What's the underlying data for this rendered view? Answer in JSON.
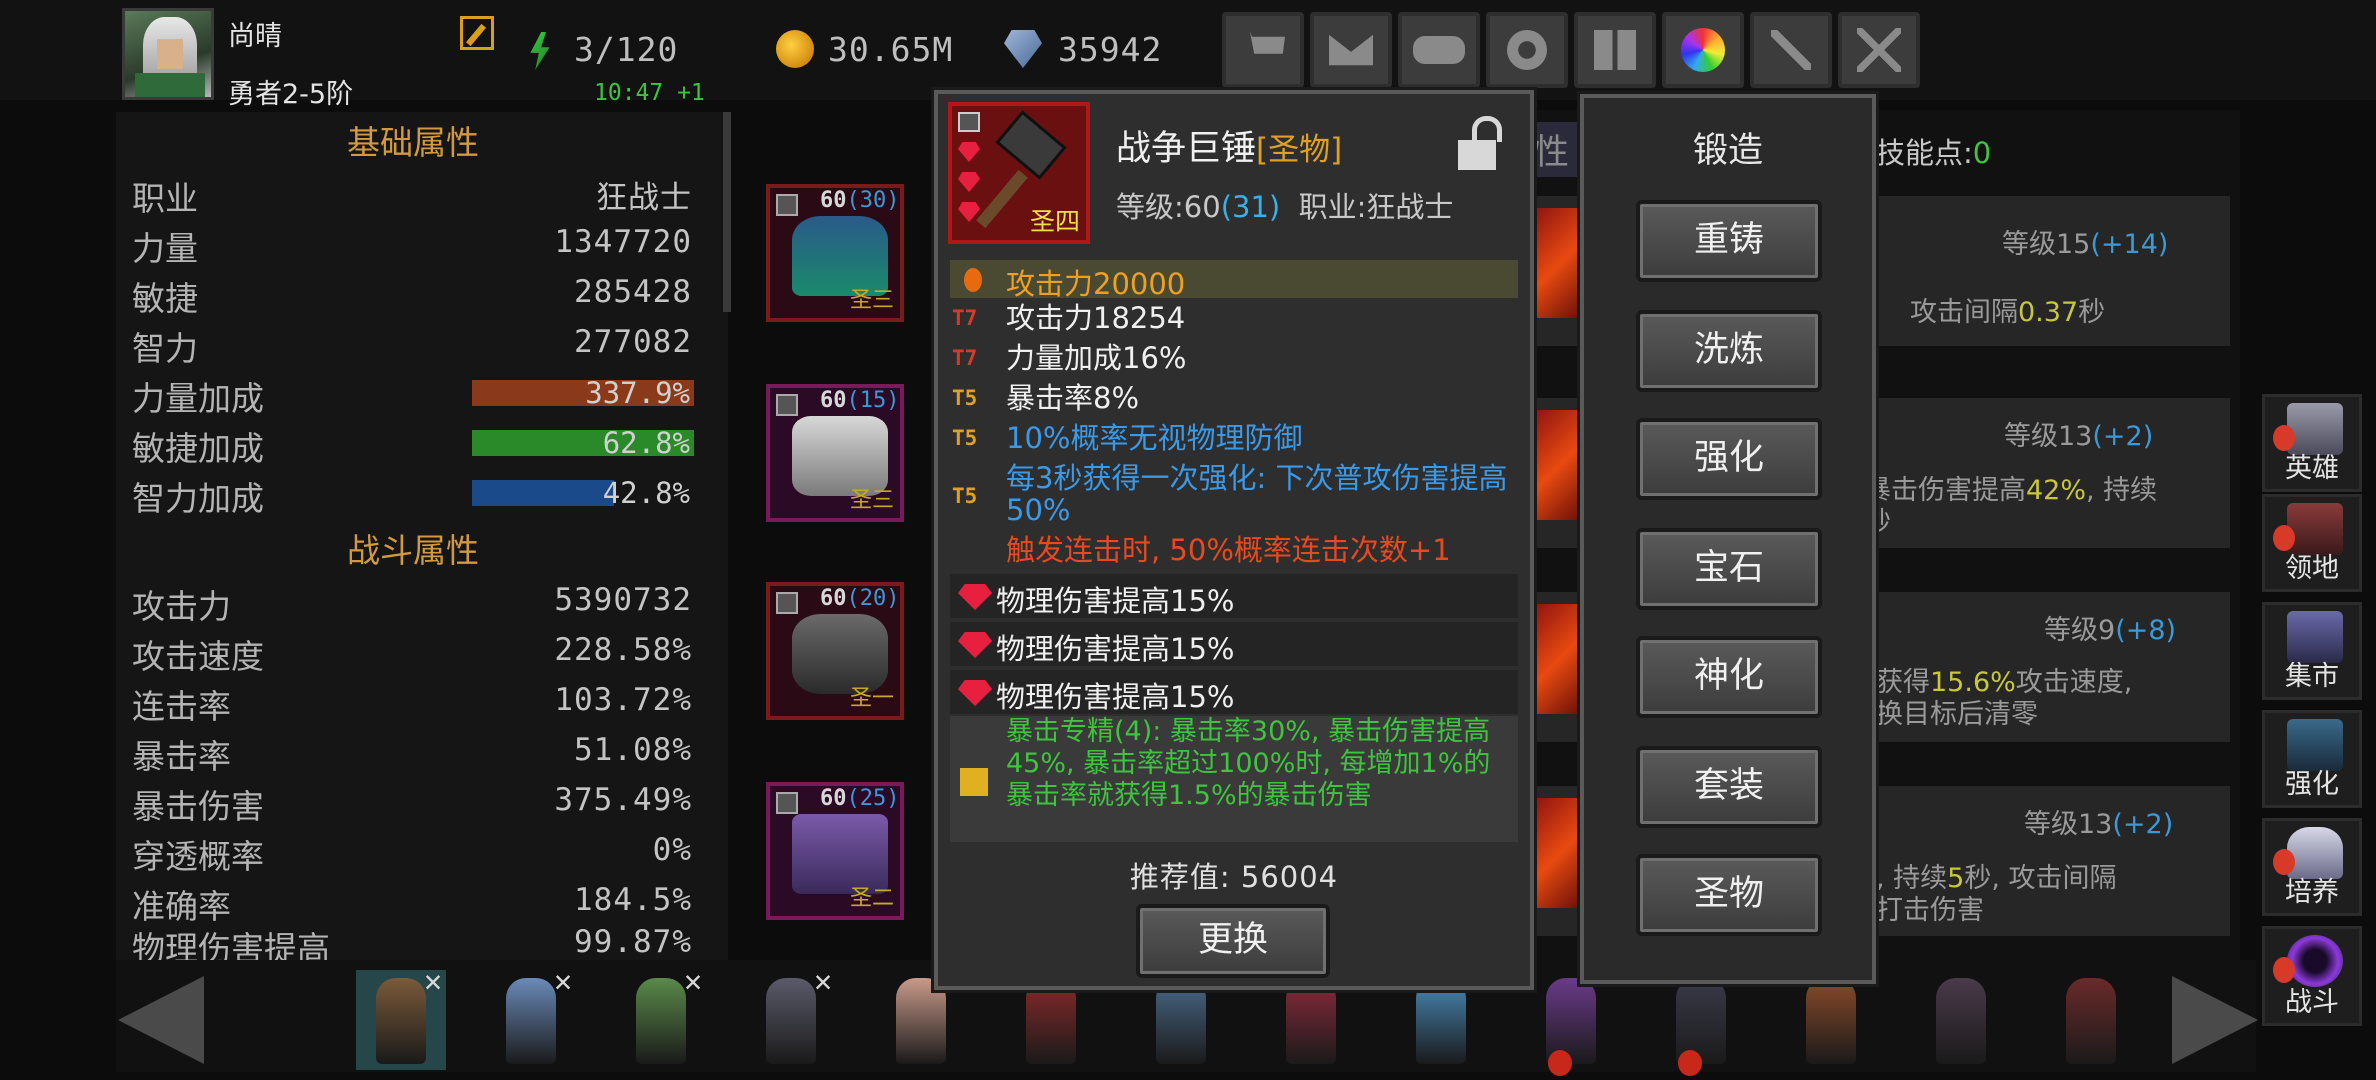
{
  "hero": {
    "name": "尚晴",
    "rank": "勇者2-5阶",
    "timer": "10:47 +1"
  },
  "resources": {
    "energy": "3/120",
    "gold": "30.65M",
    "gems": "35942"
  },
  "top_buttons": [
    "cart-icon",
    "mail-icon",
    "gamepad-icon",
    "gear-icon",
    "gift-icon",
    "lucky-wheel-icon",
    "fireworks-icon",
    "crossed-swords-icon"
  ],
  "base_attributes": {
    "title": "基础属性",
    "class_label": "职业",
    "class_value": "狂战士",
    "rows": [
      {
        "label": "力量",
        "value": "1347720"
      },
      {
        "label": "敏捷",
        "value": "285428"
      },
      {
        "label": "智力",
        "value": "277082"
      }
    ],
    "bonus_rows": [
      {
        "label": "力量加成",
        "value": "337.9%",
        "fraction": 1.0,
        "color": "#8a3a1a"
      },
      {
        "label": "敏捷加成",
        "value": "62.8%",
        "fraction": 1.0,
        "color": "#2a8a2a"
      },
      {
        "label": "智力加成",
        "value": "42.8%",
        "fraction": 0.64,
        "color": "#1a4a8a"
      }
    ]
  },
  "combat_attributes": {
    "title": "战斗属性",
    "rows": [
      {
        "label": "攻击力",
        "value": "5390732"
      },
      {
        "label": "攻击速度",
        "value": "228.58%"
      },
      {
        "label": "连击率",
        "value": "103.72%"
      },
      {
        "label": "暴击率",
        "value": "51.08%"
      },
      {
        "label": "暴击伤害",
        "value": "375.49%"
      },
      {
        "label": "穿透概率",
        "value": "0%"
      },
      {
        "label": "准确率",
        "value": "184.5%"
      },
      {
        "label": "物理伤害提高",
        "value": "99.87%"
      }
    ]
  },
  "equipment_slots": [
    {
      "level": "60",
      "bonus": "(30)",
      "tag": "圣三"
    },
    {
      "level": "60",
      "bonus": "(15)",
      "tag": "圣三"
    },
    {
      "level": "60",
      "bonus": "(20)",
      "tag": "圣一"
    },
    {
      "level": "60",
      "bonus": "(25)",
      "tag": "圣二"
    }
  ],
  "item": {
    "name": "战争巨锤",
    "quality": "[圣物]",
    "tier_badge": "圣四",
    "level_label": "等级:60",
    "level_bonus": "(31)",
    "class_label": "职业:狂战士",
    "main_stat": "攻击力20000",
    "affixes": [
      {
        "tier": "T7",
        "text": "攻击力18254",
        "tier_color": "#d83a2a",
        "color": "#f0f0f0"
      },
      {
        "tier": "T7",
        "text": "力量加成16%",
        "tier_color": "#d83a2a",
        "color": "#f0f0f0"
      },
      {
        "tier": "T5",
        "text": "暴击率8%",
        "tier_color": "#e0a020",
        "color": "#f0f0f0"
      },
      {
        "tier": "T5",
        "text": "10%概率无视物理防御",
        "tier_color": "#e0a020",
        "color": "#3a9ae8"
      },
      {
        "tier": "T5",
        "text": "每3秒获得一次强化: 下次普攻伤害提高50%",
        "tier_color": "#e0a020",
        "color": "#3a9ae8"
      },
      {
        "tier": "",
        "text": "触发连击时, 50%概率连击次数+1",
        "tier_color": "#e0a020",
        "color": "#e84a20"
      }
    ],
    "gems": [
      "物理伤害提高15%",
      "物理伤害提高15%",
      "物理伤害提高15%"
    ],
    "set_bonus": "暴击专精(4): 暴击率30%, 暴击伤害提高45%, 暴击率超过100%时, 每增加1%的暴击率就获得1.5%的暴击伤害",
    "recommend_label": "推荐值: 56004",
    "replace_label": "更换"
  },
  "forge": {
    "title": "锻造",
    "buttons": [
      "重铸",
      "洗炼",
      "强化",
      "宝石",
      "神化",
      "套装",
      "圣物"
    ]
  },
  "skills": {
    "tab_fragment": "性",
    "points_label": "技能点:",
    "points_value": "0",
    "cards": [
      {
        "level": "等级15",
        "bonus": "(+14)",
        "desc_a": "攻击间隔",
        "desc_hl": "0.37",
        "desc_b": "秒"
      },
      {
        "level": "等级13",
        "bonus": "(+2)",
        "desc_a": "暴击伤害提高",
        "desc_hl": "42%",
        "desc_b": ", 持续",
        "desc2": "秒"
      },
      {
        "level": "等级9",
        "bonus": "(+8)",
        "desc_a": "获得",
        "desc_hl": "15.6%",
        "desc_b": "攻击速度,",
        "desc2": "换目标后清零"
      },
      {
        "level": "等级13",
        "bonus": "(+2)",
        "desc_a": ", 持续",
        "desc_hl": "5",
        "desc_b": "秒, 攻击间隔",
        "desc2": "打击伤害"
      }
    ]
  },
  "side_nav": [
    "英雄",
    "领地",
    "集市",
    "强化",
    "培养",
    "战斗"
  ],
  "hero_roster_count": 14
}
